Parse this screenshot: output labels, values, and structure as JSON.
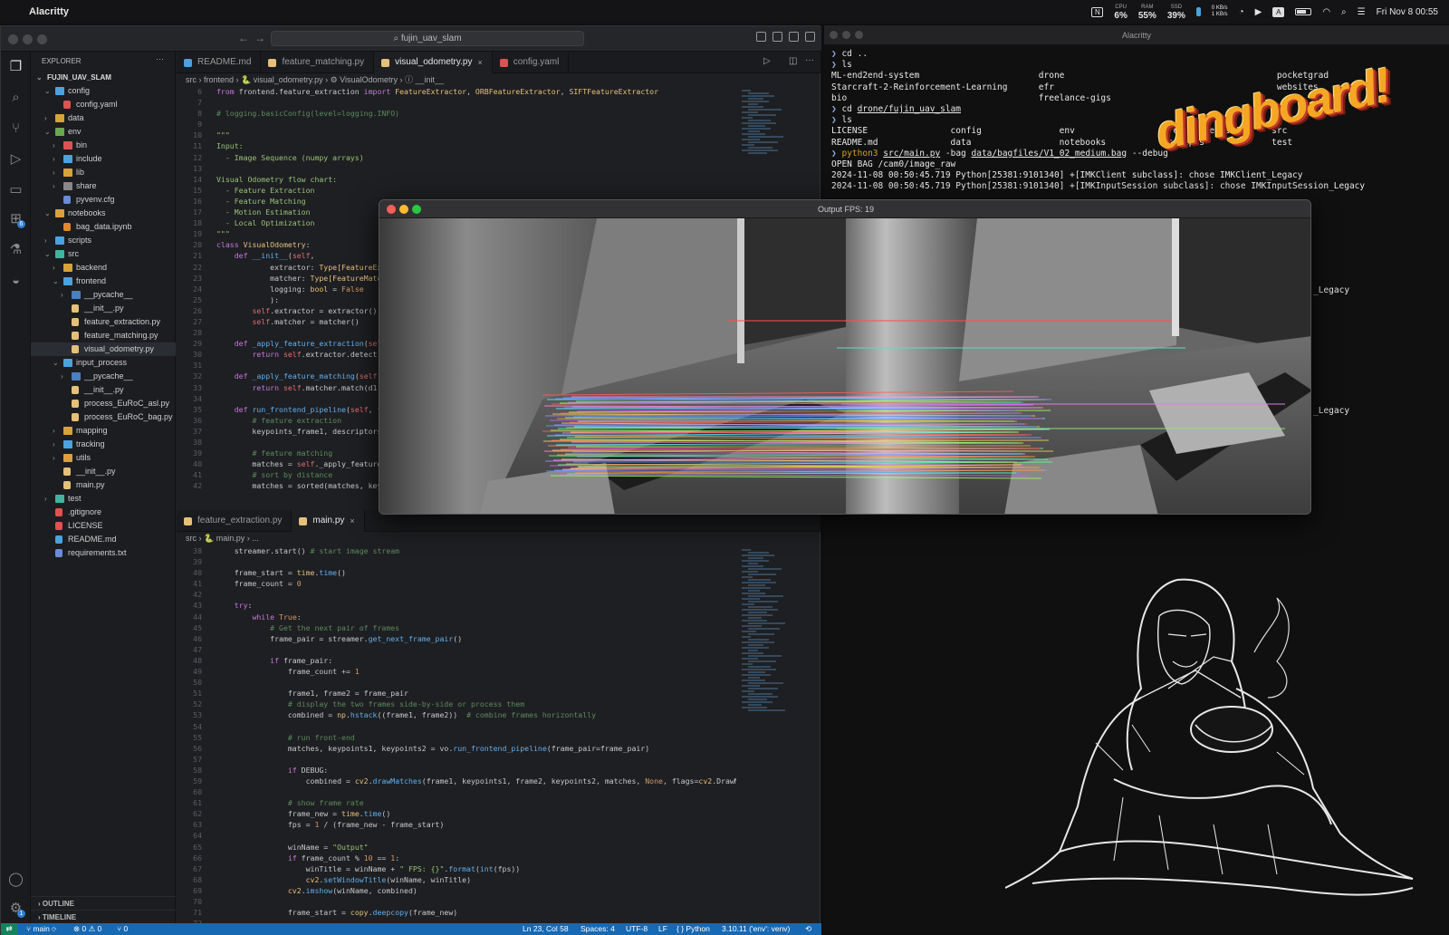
{
  "menubar": {
    "app": "Alacritty",
    "widgets": [
      {
        "k": "CPU",
        "v": "6%"
      },
      {
        "k": "RAM",
        "v": "55%"
      },
      {
        "k": "SSD",
        "v": "39%"
      },
      {
        "k": "",
        "v": "0 KB/s\n1 KB/s"
      }
    ],
    "clock": "Fri Nov 8  00:55"
  },
  "editor": {
    "search": "fujin_uav_slam",
    "explorer_title": "EXPLORER",
    "tree": [
      {
        "label": "FUJIN_UAV_SLAM",
        "depth": 0,
        "type": "root",
        "open": true
      },
      {
        "label": "config",
        "depth": 1,
        "type": "folder",
        "open": true,
        "color": "#4aa3df"
      },
      {
        "label": "config.yaml",
        "depth": 2,
        "type": "file",
        "color": "#e05252"
      },
      {
        "label": "data",
        "depth": 1,
        "type": "folder",
        "open": false,
        "color": "#d8a23a"
      },
      {
        "label": "env",
        "depth": 1,
        "type": "folder",
        "open": true,
        "color": "#6aa84f"
      },
      {
        "label": "bin",
        "depth": 2,
        "type": "folder",
        "open": false,
        "color": "#e05252"
      },
      {
        "label": "include",
        "depth": 2,
        "type": "folder",
        "open": false,
        "color": "#4aa3df"
      },
      {
        "label": "lib",
        "depth": 2,
        "type": "folder",
        "open": false,
        "color": "#d8a23a"
      },
      {
        "label": "share",
        "depth": 2,
        "type": "folder",
        "open": false,
        "color": "#888"
      },
      {
        "label": "pyvenv.cfg",
        "depth": 2,
        "type": "file",
        "color": "#6a8cd6"
      },
      {
        "label": "notebooks",
        "depth": 1,
        "type": "folder",
        "open": true,
        "color": "#d8a23a"
      },
      {
        "label": "bag_data.ipynb",
        "depth": 2,
        "type": "file",
        "color": "#e08a2a"
      },
      {
        "label": "scripts",
        "depth": 1,
        "type": "folder",
        "open": false,
        "color": "#4aa3df"
      },
      {
        "label": "src",
        "depth": 1,
        "type": "folder",
        "open": true,
        "color": "#3fb5a0"
      },
      {
        "label": "backend",
        "depth": 2,
        "type": "folder",
        "open": false,
        "color": "#d8a23a"
      },
      {
        "label": "frontend",
        "depth": 2,
        "type": "folder",
        "open": true,
        "color": "#4aa3df"
      },
      {
        "label": "__pycache__",
        "depth": 3,
        "type": "folder",
        "open": false,
        "color": "#4a7fc0"
      },
      {
        "label": "__init__.py",
        "depth": 3,
        "type": "file",
        "color": "#e5c07b"
      },
      {
        "label": "feature_extraction.py",
        "depth": 3,
        "type": "file",
        "color": "#e5c07b"
      },
      {
        "label": "feature_matching.py",
        "depth": 3,
        "type": "file",
        "color": "#e5c07b"
      },
      {
        "label": "visual_odometry.py",
        "depth": 3,
        "type": "file",
        "color": "#e5c07b",
        "selected": true
      },
      {
        "label": "input_process",
        "depth": 2,
        "type": "folder",
        "open": true,
        "color": "#4aa3df"
      },
      {
        "label": "__pycache__",
        "depth": 3,
        "type": "folder",
        "open": false,
        "color": "#4a7fc0"
      },
      {
        "label": "__init__.py",
        "depth": 3,
        "type": "file",
        "color": "#e5c07b"
      },
      {
        "label": "process_EuRoC_asl.py",
        "depth": 3,
        "type": "file",
        "color": "#e5c07b"
      },
      {
        "label": "process_EuRoC_bag.py",
        "depth": 3,
        "type": "file",
        "color": "#e5c07b"
      },
      {
        "label": "mapping",
        "depth": 2,
        "type": "folder",
        "open": false,
        "color": "#d8a23a"
      },
      {
        "label": "tracking",
        "depth": 2,
        "type": "folder",
        "open": false,
        "color": "#4aa3df"
      },
      {
        "label": "utils",
        "depth": 2,
        "type": "folder",
        "open": false,
        "color": "#d8a23a"
      },
      {
        "label": "__init__.py",
        "depth": 2,
        "type": "file",
        "color": "#e5c07b"
      },
      {
        "label": "main.py",
        "depth": 2,
        "type": "file",
        "color": "#e5c07b"
      },
      {
        "label": "test",
        "depth": 1,
        "type": "folder",
        "open": false,
        "color": "#3fb5a0"
      },
      {
        "label": ".gitignore",
        "depth": 1,
        "type": "file",
        "color": "#e05252"
      },
      {
        "label": "LICENSE",
        "depth": 1,
        "type": "file",
        "color": "#e05252"
      },
      {
        "label": "README.md",
        "depth": 1,
        "type": "file",
        "color": "#4aa3df"
      },
      {
        "label": "requirements.txt",
        "depth": 1,
        "type": "file",
        "color": "#6a8cd6"
      }
    ],
    "outline": "OUTLINE",
    "timeline": "TIMELINE",
    "top_tabs": [
      {
        "label": "README.md",
        "color": "#4aa3df",
        "active": false
      },
      {
        "label": "feature_matching.py",
        "color": "#e5c07b",
        "active": false
      },
      {
        "label": "visual_odometry.py",
        "color": "#e5c07b",
        "active": true,
        "close": "×"
      },
      {
        "label": "config.yaml",
        "color": "#e05252",
        "active": false
      }
    ],
    "top_crumb": "src › frontend › 🐍 visual_odometry.py › ⚙ VisualOdometry › ⓘ __init__",
    "top_code_start": 6,
    "top_code": [
      "<span class='kw'>from</span> frontend.feature_extraction <span class='kw'>import</span> <span class='cl'>FeatureExtractor</span>, <span class='cl'>ORBFeatureExtractor</span>, <span class='cl'>SIFTFeatureExtractor</span>",
      "",
      "<span class='cm'># logging.basicConfig(level=logging.INFO)</span>",
      "",
      "<span class='st'>\"\"\"</span>",
      "<span class='st'>Input:</span>",
      "<span class='st'>  - Image Sequence (numpy arrays)</span>",
      "",
      "<span class='st'>Visual Odometry flow chart:</span>",
      "<span class='st'>  - Feature Extraction</span>",
      "<span class='st'>  - Feature Matching</span>",
      "<span class='st'>  - Motion Estimation</span>",
      "<span class='st'>  - Local Optimization</span>",
      "<span class='st'>\"\"\"</span>",
      "<span class='kw'>class</span> <span class='cl'>VisualOdometry</span>:",
      "    <span class='kw'>def</span> <span class='fn'>__init__</span>(<span class='vr'>self</span>,",
      "            extractor: <span class='cl'>Type[FeatureExtractor]</span>,",
      "            matcher: <span class='cl'>Type[FeatureMatcher]</span>,",
      "            logging: <span class='cl'>bool</span> = <span class='nm'>False</span>",
      "            ):",
      "        <span class='vr'>self</span>.extractor = extractor()",
      "        <span class='vr'>self</span>.matcher = matcher()",
      "",
      "    <span class='kw'>def</span> <span class='fn'>_apply_feature_extraction</span>(<span class='vr'>self</span>, frame):",
      "        <span class='kw'>return</span> <span class='vr'>self</span>.extractor.detect(frame)",
      "",
      "    <span class='kw'>def</span> <span class='fn'>_apply_feature_matching</span>(<span class='vr'>self</span>, d1, d2):",
      "        <span class='kw'>return</span> <span class='vr'>self</span>.matcher.match(d1, d2)",
      "",
      "    <span class='kw'>def</span> <span class='fn'>run_frontend_pipeline</span>(<span class='vr'>self</span>, frame_pair):",
      "        <span class='cm'># feature extraction</span>",
      "        keypoints_frame1, descriptors1 = ...",
      "",
      "        <span class='cm'># feature matching</span>",
      "        matches = <span class='vr'>self</span>._apply_feature_matching(...)",
      "        <span class='cm'># sort by distance</span>",
      "        matches = sorted(matches, key=...)"
    ],
    "bottom_tabs": [
      {
        "label": "feature_extraction.py",
        "color": "#e5c07b",
        "active": false
      },
      {
        "label": "main.py",
        "color": "#e5c07b",
        "active": true,
        "close": "×"
      }
    ],
    "bottom_crumb": "src › 🐍 main.py › ...",
    "bottom_code_start": 38,
    "bottom_code": [
      "    streamer.start() <span class='cm'># start image stream</span>",
      "",
      "    frame_start = <span class='cl'>time</span>.<span class='fn'>time</span>()",
      "    frame_count = <span class='nm'>0</span>",
      "",
      "    <span class='kw'>try</span>:",
      "        <span class='kw'>while</span> <span class='nm'>True</span>:",
      "            <span class='cm'># Get the next pair of frames</span>",
      "            frame_pair = streamer.<span class='fn'>get_next_frame_pair</span>()",
      "",
      "            <span class='kw'>if</span> frame_pair:",
      "                frame_count += <span class='nm'>1</span>",
      "",
      "                frame1, frame2 = frame_pair",
      "                <span class='cm'># display the two frames side-by-side or process them</span>",
      "                combined = <span class='cl'>np</span>.<span class='fn'>hstack</span>((frame1, frame2))  <span class='cm'># combine frames horizontally</span>",
      "",
      "                <span class='cm'># run front-end</span>",
      "                matches, keypoints1, keypoints2 = vo.<span class='fn'>run_frontend_pipeline</span>(frame_pair=frame_pair)",
      "",
      "                <span class='kw'>if</span> DEBUG:",
      "                    combined = <span class='cl'>cv2</span>.<span class='fn'>drawMatches</span>(frame1, keypoints1, frame2, keypoints2, matches, <span class='nm'>None</span>, flags=<span class='cl'>cv2</span>.DrawM",
      "",
      "                <span class='cm'># show frame rate</span>",
      "                frame_new = <span class='cl'>time</span>.<span class='fn'>time</span>()",
      "                fps = <span class='nm'>1</span> / (frame_new - frame_start)",
      "",
      "                winName = <span class='st'>\"Output\"</span>",
      "                <span class='kw'>if</span> frame_count % <span class='nm'>10</span> == <span class='nm'>1</span>:",
      "                    winTitle = winName + <span class='st'>\" FPS: {}\"</span>.<span class='fn'>format</span>(<span class='fn'>int</span>(fps))",
      "                    <span class='cl'>cv2</span>.<span class='fn'>setWindowTitle</span>(winName, winTitle)",
      "                <span class='cl'>cv2</span>.<span class='fn'>imshow</span>(winName, combined)",
      "",
      "                frame_start = <span class='cl'>copy</span>.<span class='fn'>deepcopy</span>(frame_new)",
      ""
    ],
    "status": {
      "branch": "main",
      "problems": "⊗ 0 ⚠ 0",
      "ports": "⑂ 0",
      "position": "Ln 23, Col 58",
      "spaces": "Spaces: 4",
      "encoding": "UTF-8",
      "eol": "LF",
      "lang": "Python",
      "interp": "3.10.11 ('env': venv)"
    }
  },
  "terminal": {
    "title": "Alacritty",
    "lines": [
      "<span class='pr'>❯</span> cd ..",
      "<span class='pr'>❯</span> ls",
      "ML-end2end-system                       drone                                         pocketgrad",
      "Starcraft-2-Reinforcement-Learning      efr                                           websites",
      "bio                                     freelance-gigs",
      "<span class='pr'>❯</span> cd <span class='ul'>drone/fujin_uav_slam</span>",
      "<span class='pr'>❯</span> ls",
      "LICENSE                config               env                  requirements.txt    src",
      "README.md              data                 notebooks            scripts             test",
      "<span class='pr'>❯</span> <span class='pg'>python3</span> <span class='ul'>src/main.py</span> -bag <span class='ul'>data/bagfiles/V1_02_medium.bag</span> --debug",
      "OPEN BAG /cam0/image_raw",
      "2024-11-08 00:50:45.719 Python[25381:9101340] +[IMKClient subclass]: chose IMKClient_Legacy",
      "2024-11-08 00:50:45.719 Python[25381:9101340] +[IMKInputSession subclass]: chose IMKInputSession_Legacy"
    ],
    "behind_right_1": "_Legacy",
    "behind_right_2": "_Legacy",
    "sticker": "dingboard!"
  },
  "output_window": {
    "title": "Output FPS: 19"
  }
}
